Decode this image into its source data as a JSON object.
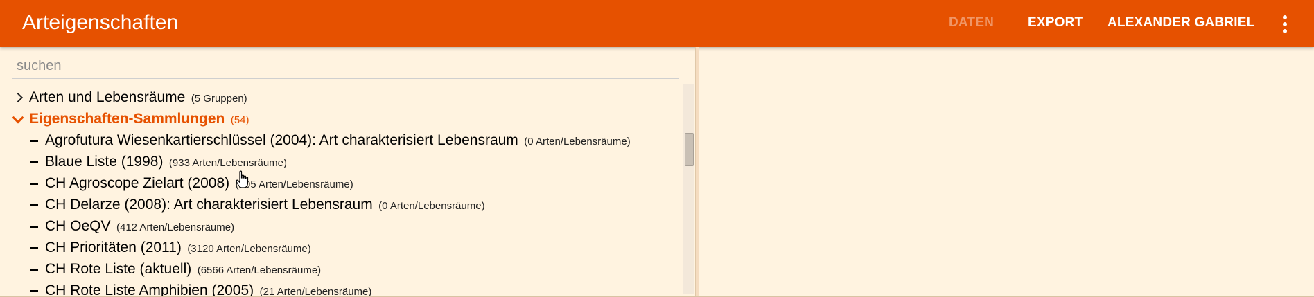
{
  "app": {
    "title": "Arteigenschaften",
    "nav": {
      "daten": "DATEN",
      "export": "EXPORT",
      "user": "ALEXANDER GABRIEL"
    },
    "colors": {
      "accent": "#e65100",
      "background": "#fff3e0"
    }
  },
  "search": {
    "placeholder": "suchen",
    "value": ""
  },
  "tree": {
    "groups": [
      {
        "label": "Arten und Lebensräume",
        "count": "(5 Gruppen)",
        "expanded": false,
        "icon": "chevron-right-icon"
      },
      {
        "label": "Eigenschaften-Sammlungen",
        "count": "(54)",
        "expanded": true,
        "icon": "chevron-down-icon"
      }
    ],
    "items": [
      {
        "label": "Agrofutura Wiesenkartierschlüssel (2004): Art charakterisiert Lebensraum",
        "count": "(0 Arten/Lebensräume)"
      },
      {
        "label": "Blaue Liste (1998)",
        "count": "(933 Arten/Lebensräume)"
      },
      {
        "label": "CH Agroscope Zielart (2008)",
        "count": "(205 Arten/Lebensräume)"
      },
      {
        "label": "CH Delarze (2008): Art charakterisiert Lebensraum",
        "count": "(0 Arten/Lebensräume)"
      },
      {
        "label": "CH OeQV",
        "count": "(412 Arten/Lebensräume)"
      },
      {
        "label": "CH Prioritäten (2011)",
        "count": "(3120 Arten/Lebensräume)"
      },
      {
        "label": "CH Rote Liste (aktuell)",
        "count": "(6566 Arten/Lebensräume)"
      },
      {
        "label": "CH Rote Liste Amphibien (2005)",
        "count": "(21 Arten/Lebensräume)"
      }
    ]
  }
}
